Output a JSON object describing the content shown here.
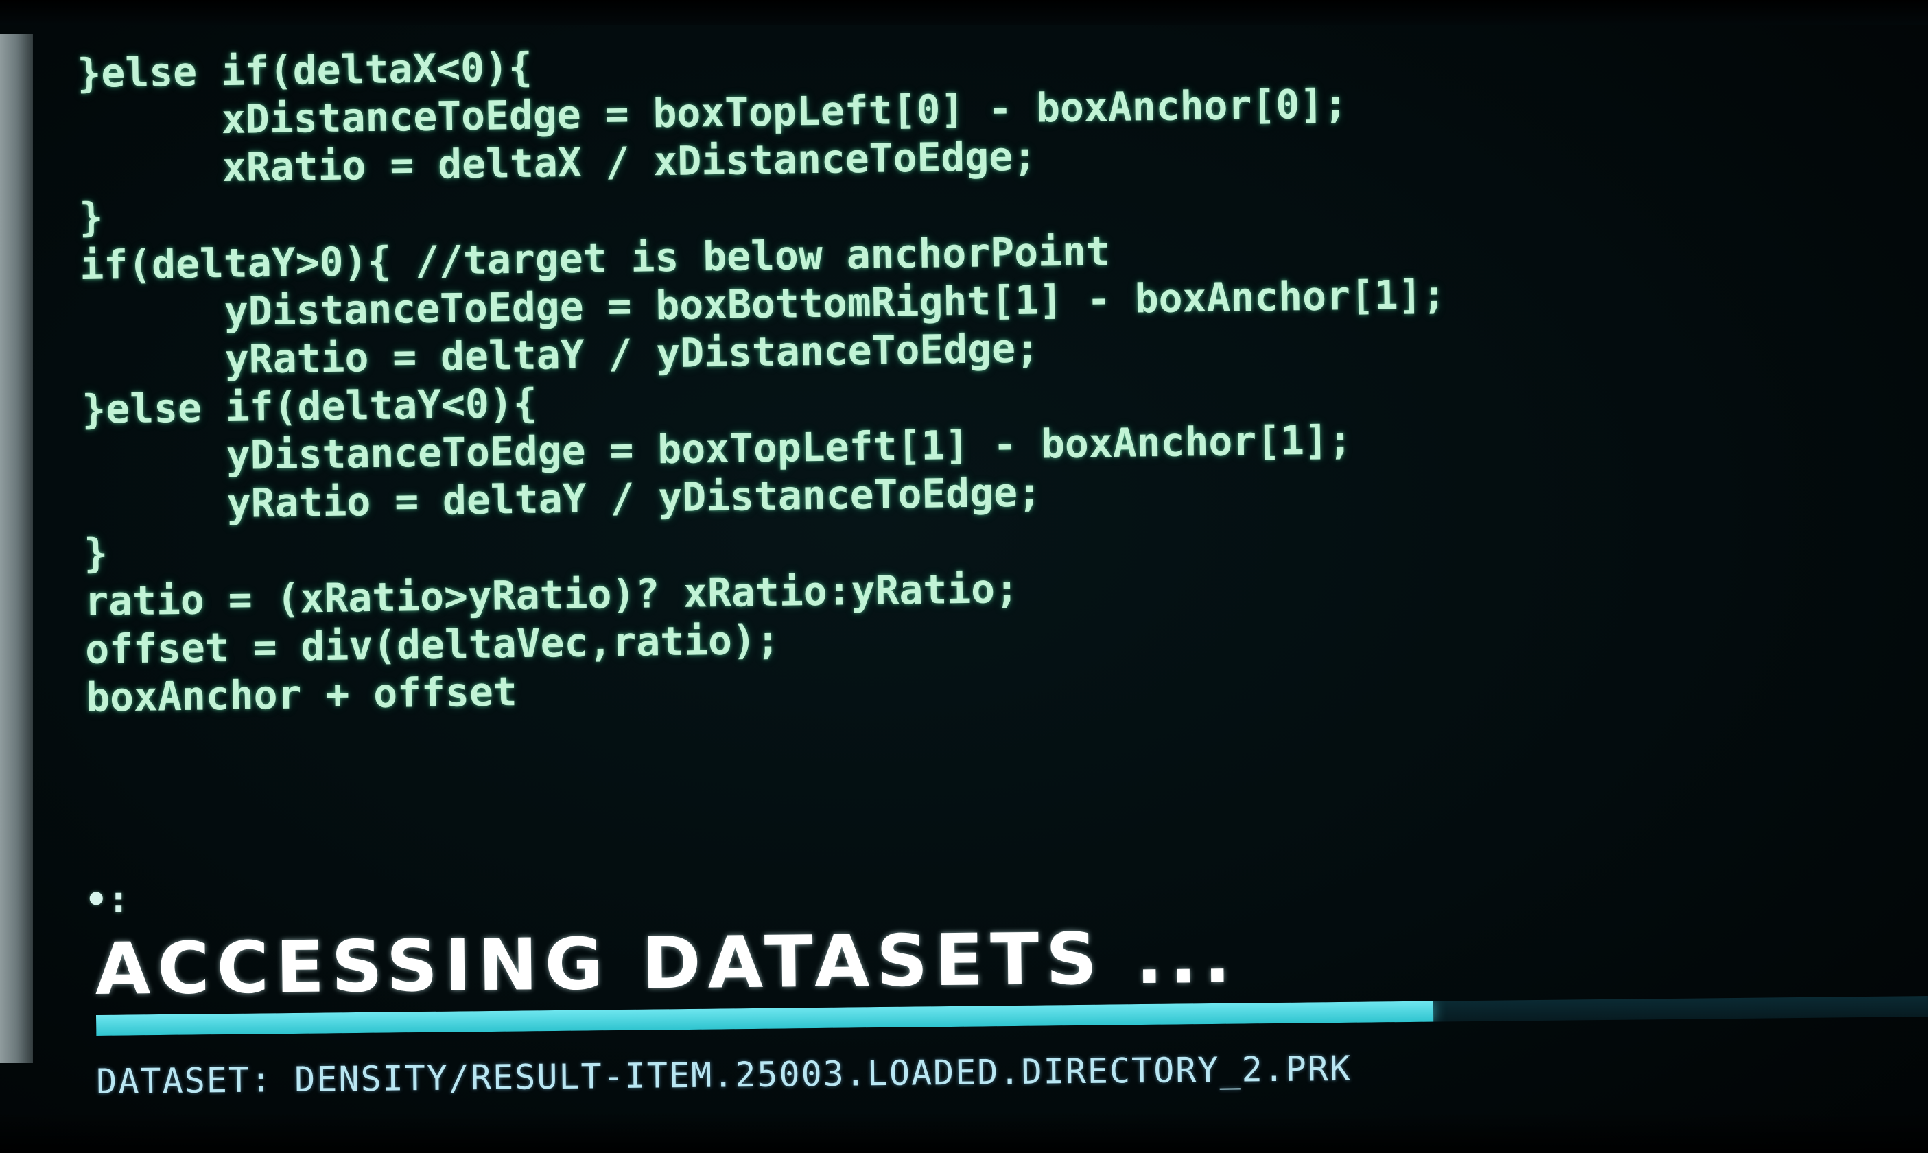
{
  "code": {
    "lines": [
      "}else if(deltaX<0){",
      "      xDistanceToEdge = boxTopLeft[0] - boxAnchor[0];",
      "      xRatio = deltaX / xDistanceToEdge;",
      "}",
      "if(deltaY>0){ //target is below anchorPoint",
      "      yDistanceToEdge = boxBottomRight[1] - boxAnchor[1];",
      "      yRatio = deltaY / yDistanceToEdge;",
      "}else if(deltaY<0){",
      "      yDistanceToEdge = boxTopLeft[1] - boxAnchor[1];",
      "      yRatio = deltaY / yDistanceToEdge;",
      "}",
      "ratio = (xRatio>yRatio)? xRatio:yRatio;",
      "offset = div(deltaVec,ratio);",
      "boxAnchor + offset"
    ]
  },
  "prompt": {
    "glyph": "•:"
  },
  "status": {
    "heading": "ACCESSING DATASETS ...",
    "progress_fraction": 0.73,
    "accent_color": "#4fd8e3",
    "dataset_line": "DATASET: DENSITY/RESULT-ITEM.25003.LOADED.DIRECTORY_2.PRK"
  }
}
